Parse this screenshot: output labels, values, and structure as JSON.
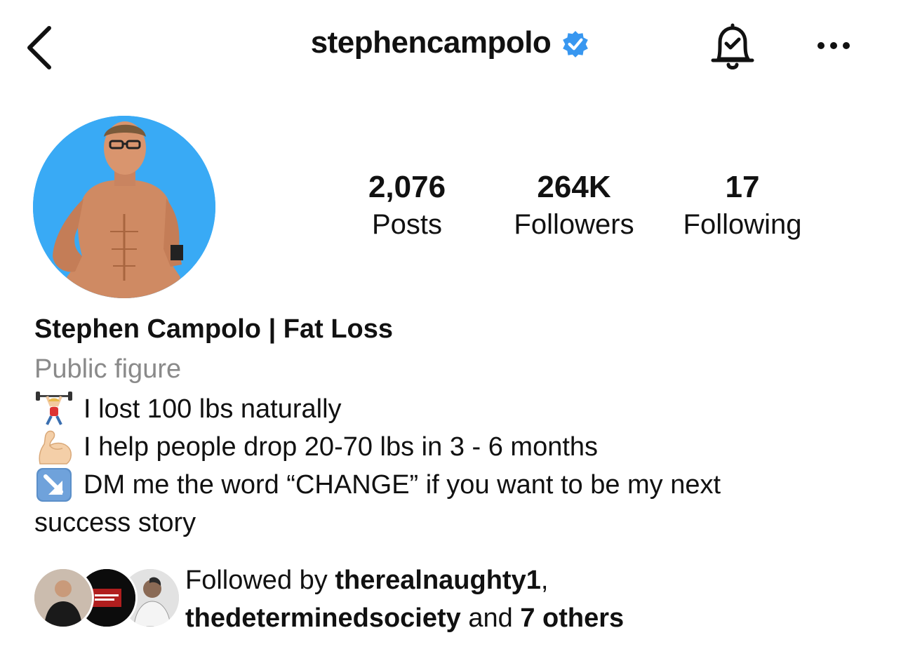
{
  "header": {
    "username": "stephencampolo",
    "verified": true,
    "verified_color": "#3897f0",
    "back_icon": "chevron-left-icon",
    "bell_icon": "bell-check-icon",
    "more_icon": "more-horizontal-icon"
  },
  "profile": {
    "avatar_bg": "#39aaf5",
    "stats": [
      {
        "value": "2,076",
        "label": "Posts"
      },
      {
        "value": "264K",
        "label": "Followers"
      },
      {
        "value": "17",
        "label": "Following"
      }
    ],
    "full_name": "Stephen Campolo | Fat Loss",
    "category": "Public figure",
    "bio": [
      {
        "icon": "weightlifter-emoji",
        "text": "I lost 100 lbs naturally"
      },
      {
        "icon": "flexed-biceps-emoji",
        "text": "I help people drop 20-70 lbs in 3 - 6 months"
      },
      {
        "icon": "down-right-arrow-emoji",
        "text": "DM me the word “CHANGE” if you want to be my next"
      }
    ],
    "bio_continued": "success story"
  },
  "followed_by": {
    "prefix": "Followed by ",
    "user1": "therealnaughty1",
    "separator": ",",
    "user2": "thedeterminedsociety",
    "connector": " and ",
    "others": "7 others"
  }
}
